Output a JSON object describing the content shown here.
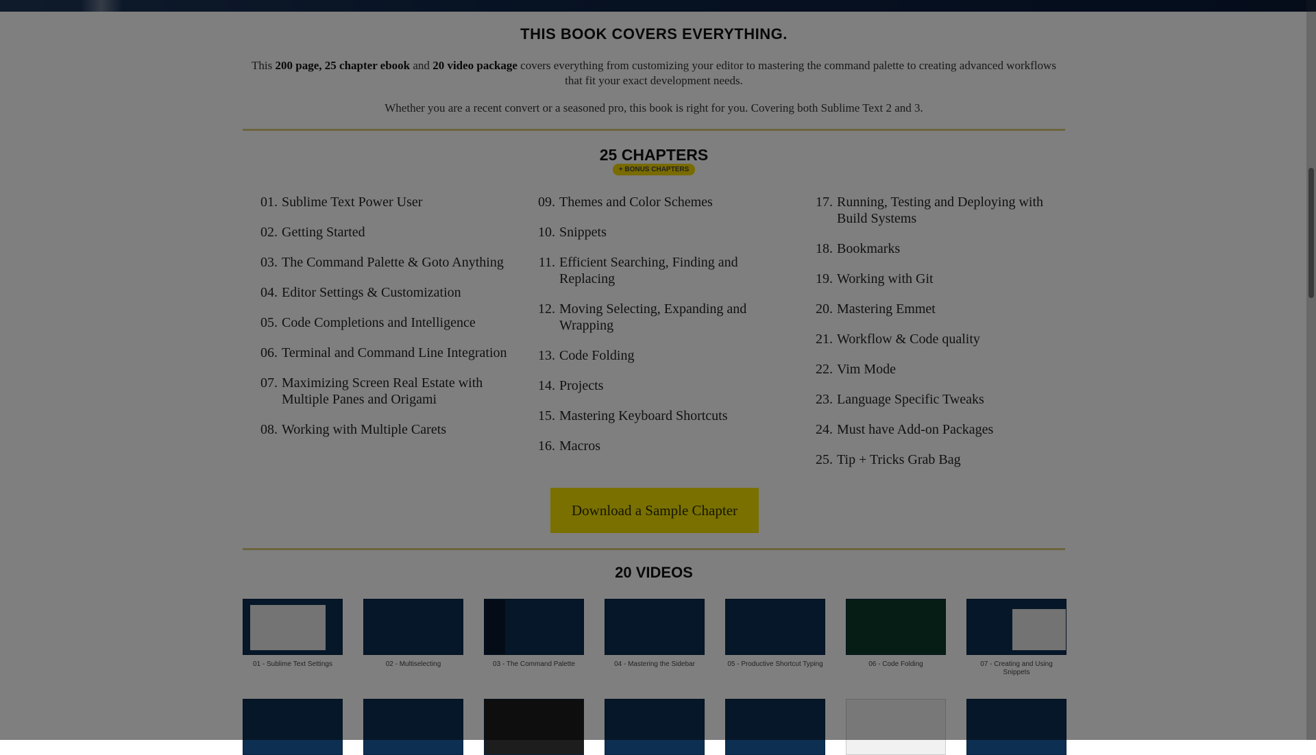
{
  "main_heading": "THIS BOOK COVERS EVERYTHING.",
  "intro": {
    "lead": "This ",
    "bold1": "200 page, 25 chapter ebook",
    "mid": " and ",
    "bold2": "20 video package",
    "rest": " covers everything from customizing your editor to mastering the command palette to creating advanced workflows that fit your exact development needs.",
    "line2": "Whether you are a recent convert or a seasoned pro, this book is right for you. Covering both Sublime Text 2 and 3."
  },
  "chapters_heading": "25 CHAPTERS",
  "chapters_badge": "+ BONUS CHAPTERS",
  "chapters": {
    "col1": [
      {
        "num": "01.",
        "title": "Sublime Text Power User"
      },
      {
        "num": "02.",
        "title": "Getting Started"
      },
      {
        "num": "03.",
        "title": "The Command Palette & Goto Anything"
      },
      {
        "num": "04.",
        "title": "Editor Settings & Customization"
      },
      {
        "num": "05.",
        "title": "Code Completions and Intelligence"
      },
      {
        "num": "06.",
        "title": "Terminal and Command Line Integration"
      },
      {
        "num": "07.",
        "title": "Maximizing Screen Real Estate with Multiple Panes and Origami"
      },
      {
        "num": "08.",
        "title": "Working with Multiple Carets"
      }
    ],
    "col2": [
      {
        "num": "09.",
        "title": "Themes and Color Schemes"
      },
      {
        "num": "10.",
        "title": "Snippets"
      },
      {
        "num": "11.",
        "title": "Efficient Searching, Finding and Replacing"
      },
      {
        "num": "12.",
        "title": "Moving Selecting, Expanding and Wrapping"
      },
      {
        "num": "13.",
        "title": "Code Folding"
      },
      {
        "num": "14.",
        "title": "Projects"
      },
      {
        "num": "15.",
        "title": "Mastering Keyboard Shortcuts"
      },
      {
        "num": "16.",
        "title": "Macros"
      }
    ],
    "col3": [
      {
        "num": "17.",
        "title": "Running, Testing and Deploying with Build Systems"
      },
      {
        "num": "18.",
        "title": "Bookmarks"
      },
      {
        "num": "19.",
        "title": "Working with Git"
      },
      {
        "num": "20.",
        "title": "Mastering Emmet"
      },
      {
        "num": "21.",
        "title": "Workflow & Code quality"
      },
      {
        "num": "22.",
        "title": "Vim Mode"
      },
      {
        "num": "23.",
        "title": "Language Specific Tweaks"
      },
      {
        "num": "24.",
        "title": "Must have Add-on Packages"
      },
      {
        "num": "25.",
        "title": "Tip + Tricks Grab Bag"
      }
    ]
  },
  "download_button": "Download a Sample Chapter",
  "videos_heading": "20 VIDEOS",
  "videos": [
    {
      "label": "01 - Sublime Text Settings"
    },
    {
      "label": "02 - Multiselecting"
    },
    {
      "label": "03 - The Command Palette"
    },
    {
      "label": "04 - Mastering the Sidebar"
    },
    {
      "label": "05 - Productive Shortcut Typing"
    },
    {
      "label": "06 - Code Folding"
    },
    {
      "label": "07 - Creating and Using Snippets"
    }
  ],
  "colors": {
    "accent_yellow": "#f2e100",
    "divider": "#d9c77a",
    "thumb_bg": "#0d2f52",
    "topbar": "#0e2447"
  }
}
